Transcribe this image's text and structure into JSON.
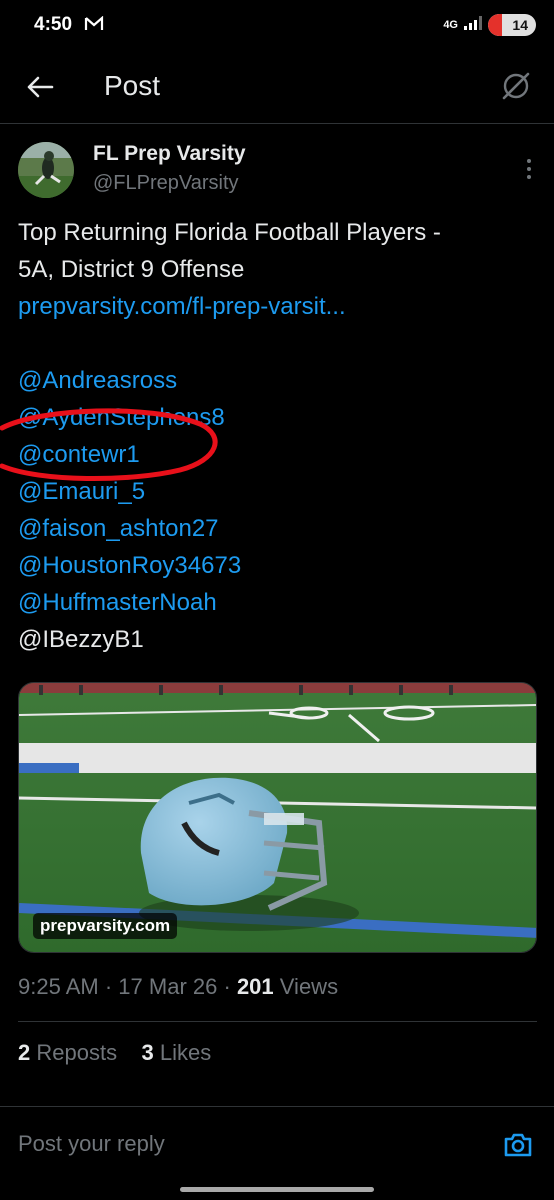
{
  "status_bar": {
    "time": "4:50",
    "network": "4G",
    "battery": "14",
    "mail_icon": "gmail-icon",
    "colors": {
      "battery_low": "#e4312b"
    }
  },
  "header": {
    "title": "Post",
    "back_icon": "arrow-left-icon",
    "grok_icon": "grok-icon"
  },
  "post": {
    "author": {
      "name": "FL Prep Varsity",
      "handle": "@FLPrepVarsity"
    },
    "text": {
      "line1": "Top Returning Florida Football Players -",
      "line2": "5A, District 9 Offense",
      "link": "prepvarsity.com/fl-prep-varsit..."
    },
    "mentions": [
      "@Andreasross",
      "@AydenStephens8",
      "@contewr1",
      "@Emauri_5",
      "@faison_ashton27",
      "@HoustonRoy34673",
      "@HuffmasterNoah",
      "@IBezzyB1"
    ],
    "media": {
      "caption": "prepvarsity.com"
    },
    "meta": {
      "time": "9:25 AM",
      "date": "17 Mar 26",
      "views_count": "201",
      "views_label": "Views"
    },
    "stats": {
      "reposts_count": "2",
      "reposts_label": "Reposts",
      "likes_count": "3",
      "likes_label": "Likes"
    }
  },
  "reply": {
    "placeholder": "Post your reply"
  },
  "colors": {
    "background": "#000000",
    "text": "#e7e9ea",
    "muted": "#71767b",
    "link": "#1d9bf0",
    "annotation": "#e8101a"
  }
}
